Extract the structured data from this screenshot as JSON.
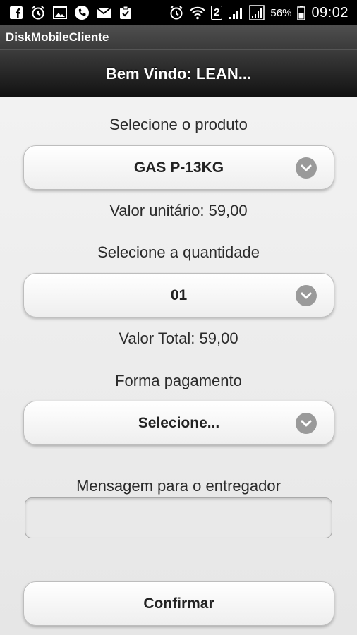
{
  "status_bar": {
    "left_icons": [
      "facebook-icon",
      "alarm-icon",
      "image-icon",
      "phone-icon",
      "mail-icon",
      "clipboard-icon"
    ],
    "right_icons": [
      "alarm-icon",
      "wifi-icon",
      "sim-icon",
      "signal-icon",
      "signal-icon",
      "battery-icon"
    ],
    "sim_number": "2",
    "battery": "56%",
    "time": "09:02"
  },
  "app": {
    "title": "DiskMobileCliente"
  },
  "header": {
    "title": "Bem Vindo: LEAN..."
  },
  "form": {
    "product_label": "Selecione o produto",
    "product_value": "GAS P-13KG",
    "unit_price_text": "Valor unitário: 59,00",
    "quantity_label": "Selecione a quantidade",
    "quantity_value": "01",
    "total_text": "Valor Total: 59,00",
    "payment_label": "Forma pagamento",
    "payment_value": "Selecione...",
    "message_label": "Mensagem para o entregador",
    "message_value": "",
    "confirm_label": "Confirmar"
  },
  "colors": {
    "header_bg": "#111111",
    "page_bg": "#ececec",
    "chevron_bg": "#9a9a9a"
  }
}
